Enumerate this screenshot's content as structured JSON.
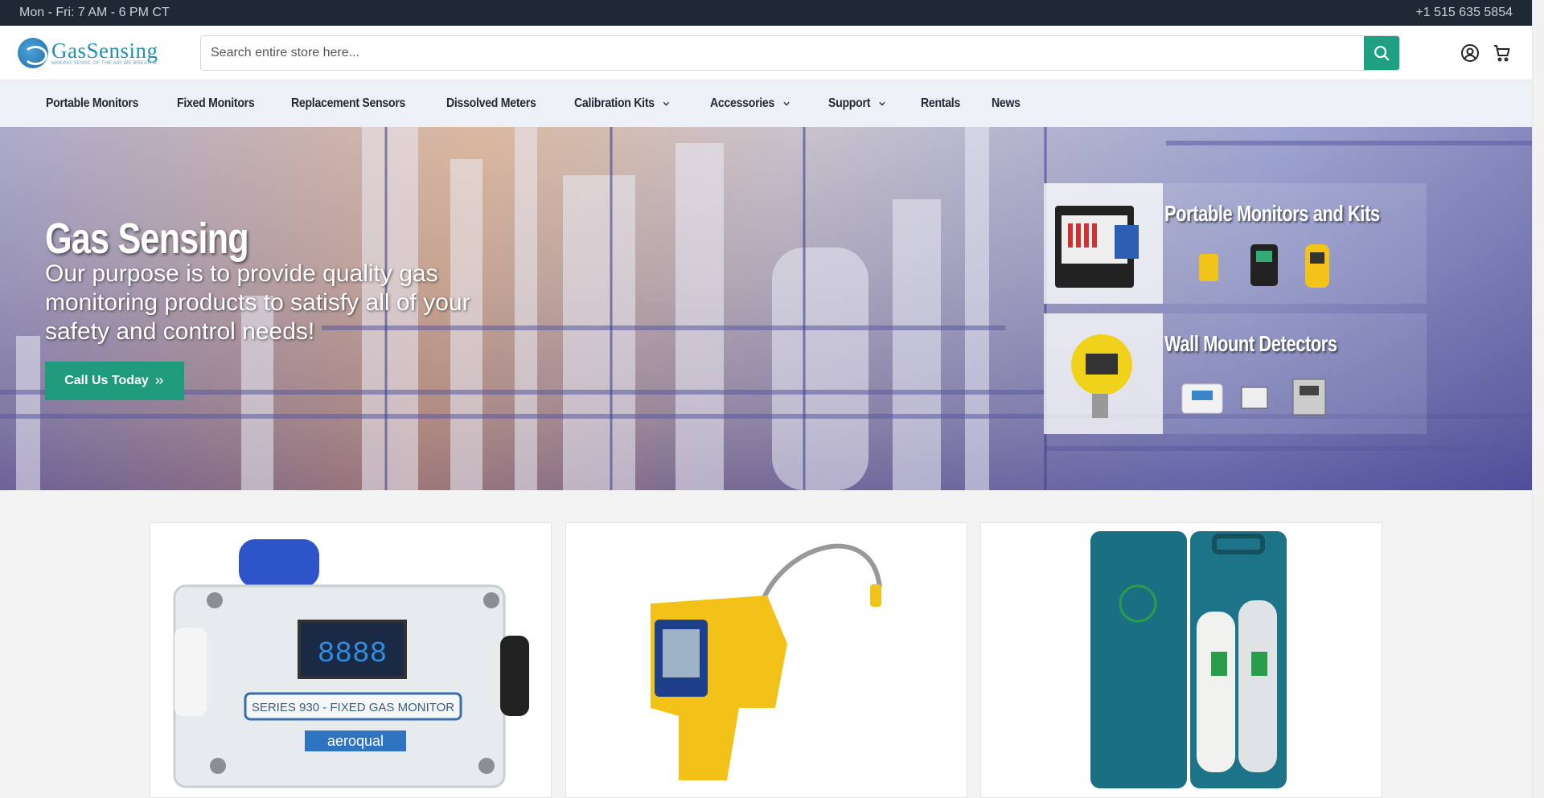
{
  "topbar": {
    "hours": "Mon - Fri: 7 AM - 6 PM CT",
    "phone": "+1 515 635 5854"
  },
  "brand": {
    "name": "GasSensing",
    "tagline": "MAKING SENSE OF THE AIR WE BREATHE"
  },
  "search": {
    "placeholder": "Search entire store here...",
    "value": ""
  },
  "nav": {
    "items": [
      {
        "label": "Portable Monitors",
        "dropdown": false
      },
      {
        "label": "Fixed Monitors",
        "dropdown": false
      },
      {
        "label": "Replacement Sensors",
        "dropdown": false
      },
      {
        "label": "Dissolved Meters",
        "dropdown": false
      },
      {
        "label": "Calibration Kits",
        "dropdown": true
      },
      {
        "label": "Accessories",
        "dropdown": true
      },
      {
        "label": "Support",
        "dropdown": true
      },
      {
        "label": "Rentals",
        "dropdown": false
      },
      {
        "label": "News",
        "dropdown": false
      }
    ]
  },
  "hero": {
    "title": "Gas Sensing",
    "subtitle": "Our purpose is to provide quality gas monitoring products to satisfy all of your safety and control needs!",
    "cta_label": "Call Us Today"
  },
  "promos": [
    {
      "title": "Portable Monitors and Kits"
    },
    {
      "title": "Wall Mount Detectors"
    }
  ],
  "products": [
    {
      "panel_label": "SERIES 930 - FIXED GAS MONITOR",
      "brand_label": "aeroqual",
      "display": "8888"
    },
    {
      "panel_label": ""
    },
    {
      "panel_label": ""
    }
  ],
  "colors": {
    "accent": "#1fa082",
    "topbar": "#1f2933",
    "nav_bg": "#eef0f7"
  }
}
